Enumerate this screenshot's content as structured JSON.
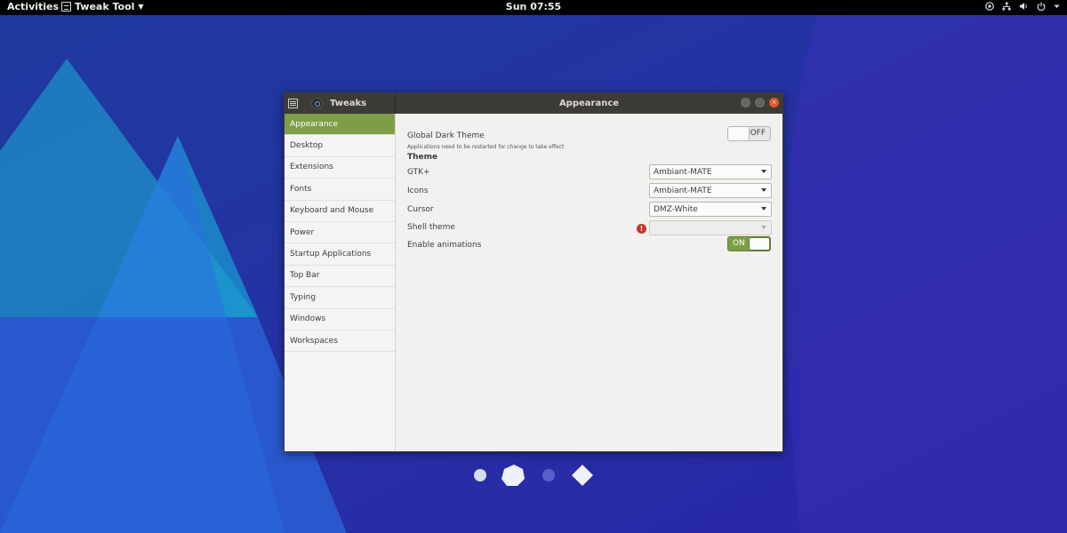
{
  "topbar": {
    "activities": "Activities",
    "app_name": "Tweak Tool",
    "clock": "Sun 07:55",
    "tray_icons": [
      "accessibility-icon",
      "network-icon",
      "volume-icon",
      "power-icon",
      "menu-arrow-icon"
    ]
  },
  "window": {
    "sidebar_title": "Tweaks",
    "title": "Appearance",
    "controls": {
      "minimize": "–",
      "maximize": "□",
      "close": "×"
    }
  },
  "sidebar": {
    "items": [
      {
        "label": "Appearance",
        "active": true
      },
      {
        "label": "Desktop"
      },
      {
        "label": "Extensions"
      },
      {
        "label": "Fonts"
      },
      {
        "label": "Keyboard and Mouse"
      },
      {
        "label": "Power"
      },
      {
        "label": "Startup Applications"
      },
      {
        "label": "Top Bar"
      },
      {
        "label": "Typing"
      },
      {
        "label": "Windows"
      },
      {
        "label": "Workspaces"
      }
    ]
  },
  "appearance": {
    "dark_theme_label": "Global Dark Theme",
    "dark_theme_hint": "Applications need to be restarted for change to take effect",
    "dark_theme_state": "OFF",
    "section_theme": "Theme",
    "gtk_label": "GTK+",
    "gtk_value": "Ambiant-MATE",
    "icons_label": "Icons",
    "icons_value": "Ambiant-MATE",
    "cursor_label": "Cursor",
    "cursor_value": "DMZ-White",
    "shell_label": "Shell theme",
    "shell_value": "",
    "shell_warning": "!",
    "animations_label": "Enable animations",
    "animations_state": "ON"
  },
  "colors": {
    "accent": "#7d9e47",
    "titlebar": "#3c3b37",
    "close_button": "#e2572a",
    "warning": "#c8352b"
  }
}
